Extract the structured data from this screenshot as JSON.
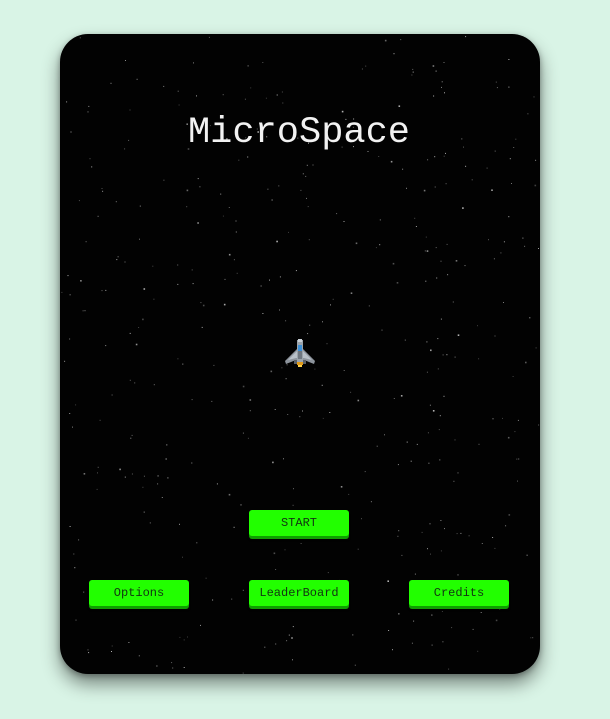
{
  "game": {
    "title": "MicroSpace"
  },
  "menu": {
    "start_label": "START",
    "options_label": "Options",
    "leaderboard_label": "LeaderBoard",
    "credits_label": "Credits"
  },
  "colors": {
    "page_background": "#d9f4e6",
    "card_background": "#020202",
    "button": "#22ff00",
    "title_text": "#f2f2f2"
  },
  "icons": {
    "player_ship": "spaceship-icon"
  }
}
